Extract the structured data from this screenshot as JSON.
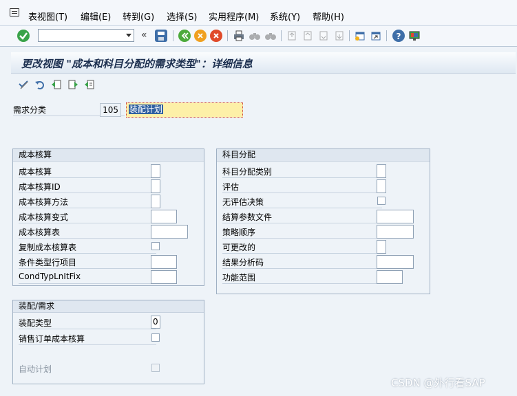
{
  "menubar": {
    "items": [
      "表视图(T)",
      "编辑(E)",
      "转到(G)",
      "选择(S)",
      "实用程序(M)",
      "系统(Y)",
      "帮助(H)"
    ]
  },
  "toolbar": {
    "command_value": ""
  },
  "title": "更改视图 \"成本和科目分配的需求类型\"：详细信息",
  "header": {
    "req_class_label": "需求分类",
    "req_class_value": "105",
    "req_class_desc": "装配计划"
  },
  "costing": {
    "title": "成本核算",
    "rows": [
      {
        "label": "成本核算",
        "type": "short"
      },
      {
        "label": "成本核算ID",
        "type": "short"
      },
      {
        "label": "成本核算方法",
        "type": "short"
      },
      {
        "label": "成本核算变式",
        "type": "medium"
      },
      {
        "label": "成本核算表",
        "type": "long"
      },
      {
        "label": "复制成本核算表",
        "type": "check"
      },
      {
        "label": "条件类型行项目",
        "type": "medium"
      },
      {
        "label": "CondTypLnItFix",
        "type": "medium"
      }
    ]
  },
  "account": {
    "title": "科目分配",
    "rows": [
      {
        "label": "科目分配类别",
        "type": "short"
      },
      {
        "label": "评估",
        "type": "short"
      },
      {
        "label": "无评估决策",
        "type": "check"
      },
      {
        "label": "结算参数文件",
        "type": "long"
      },
      {
        "label": "策略顺序",
        "type": "long"
      },
      {
        "label": "可更改的",
        "type": "short"
      },
      {
        "label": "结果分析码",
        "type": "long"
      },
      {
        "label": "功能范围",
        "type": "medium"
      }
    ]
  },
  "assembly": {
    "title": "装配/需求",
    "assembly_type_label": "装配类型",
    "assembly_type_value": "0",
    "sales_order_costing_label": "销售订单成本核算",
    "auto_planning_label": "自动计划"
  },
  "watermark": "CSDN @外行看SAP"
}
